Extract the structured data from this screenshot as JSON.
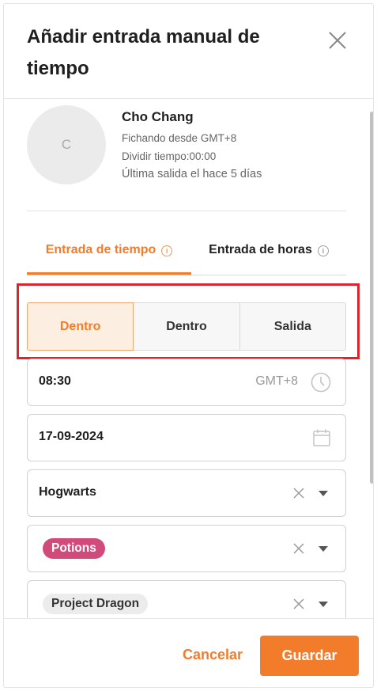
{
  "dialog": {
    "title": "Añadir entrada manual de tiempo"
  },
  "user": {
    "avatar_initial": "C",
    "name": "Cho Chang",
    "clocking_since": "Fichando desde GMT+8",
    "split_time": "Dividir tiempo:00:00",
    "last_out": "Última salida el hace 5 días"
  },
  "tabs": [
    {
      "label": "Entrada de tiempo",
      "active": true
    },
    {
      "label": "Entrada de horas",
      "active": false
    }
  ],
  "entry_type": {
    "options": [
      {
        "label": "Dentro",
        "active": true
      },
      {
        "label": "Dentro",
        "active": false
      },
      {
        "label": "Salida",
        "active": false
      }
    ]
  },
  "fields": {
    "time": {
      "value": "08:30",
      "timezone": "GMT+8"
    },
    "date": {
      "value": "17-09-2024"
    },
    "location": {
      "value": "Hogwarts"
    },
    "activity": {
      "tag": "Potions",
      "tag_color": "#d24a7a"
    },
    "project": {
      "tag": "Project Dragon"
    }
  },
  "footer": {
    "cancel_label": "Cancelar",
    "save_label": "Guardar"
  },
  "colors": {
    "accent": "#f37c2b",
    "highlight_border": "#d9262e"
  }
}
